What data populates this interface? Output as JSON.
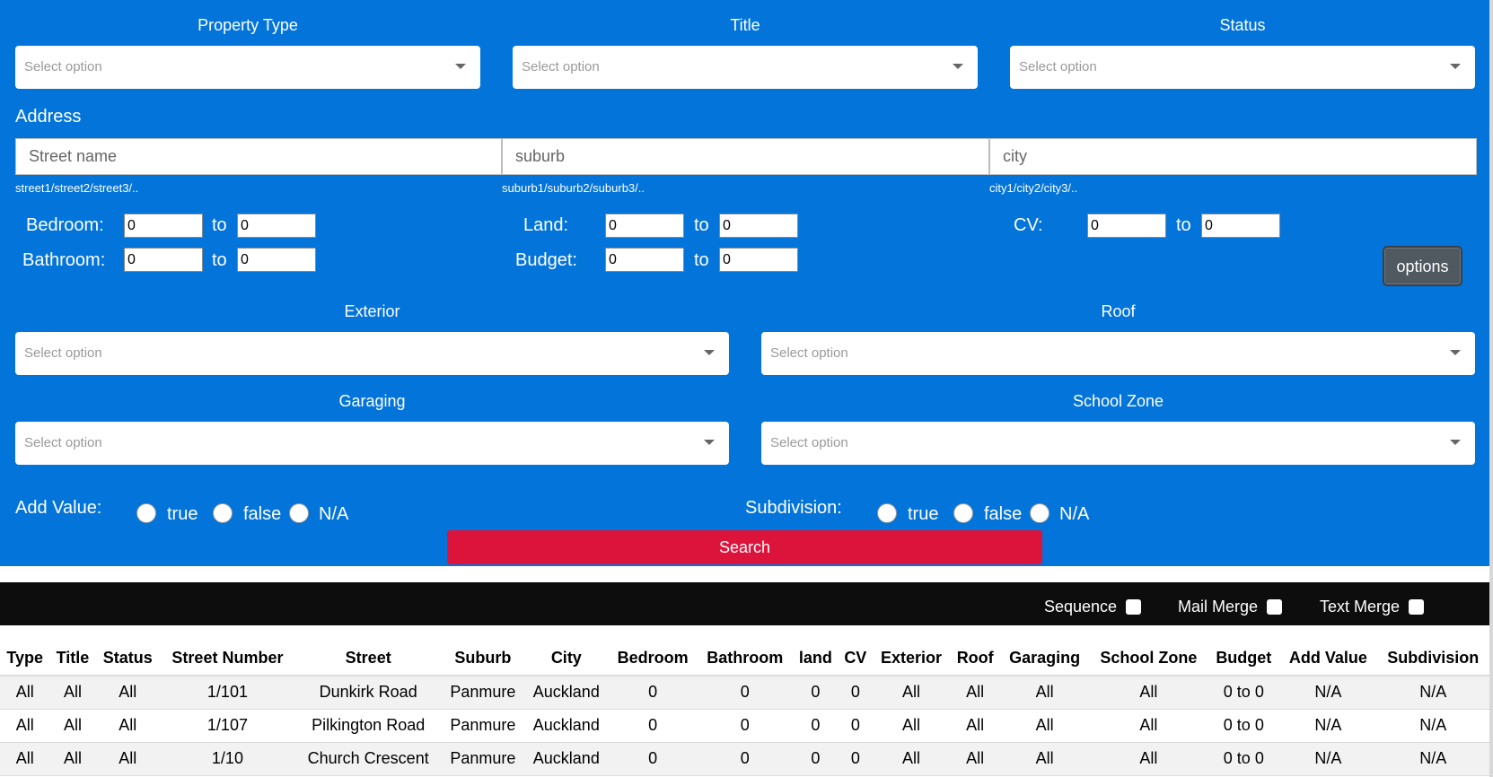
{
  "top_selects": [
    {
      "label": "Property Type",
      "placeholder": "Select option"
    },
    {
      "label": "Title",
      "placeholder": "Select option"
    },
    {
      "label": "Status",
      "placeholder": "Select option"
    }
  ],
  "address": {
    "title": "Address",
    "street": {
      "placeholder": "Street name",
      "hint": "street1/street2/street3/.."
    },
    "suburb": {
      "placeholder": "suburb",
      "hint": "suburb1/suburb2/suburb3/.."
    },
    "city": {
      "placeholder": "city",
      "hint": "city1/city2/city3/.."
    }
  },
  "ranges": {
    "to_label": "to",
    "bedroom": {
      "label": "Bedroom:",
      "from": "0",
      "to": "0"
    },
    "bathroom": {
      "label": "Bathroom:",
      "from": "0",
      "to": "0"
    },
    "land": {
      "label": "Land:",
      "from": "0",
      "to": "0"
    },
    "budget": {
      "label": "Budget:",
      "from": "0",
      "to": "0"
    },
    "cv": {
      "label": "CV:",
      "from": "0",
      "to": "0"
    }
  },
  "options_button": "options",
  "mid_selects": [
    {
      "label": "Exterior",
      "placeholder": "Select option"
    },
    {
      "label": "Roof",
      "placeholder": "Select option"
    },
    {
      "label": "Garaging",
      "placeholder": "Select option"
    },
    {
      "label": "School Zone",
      "placeholder": "Select option"
    }
  ],
  "add_value": {
    "label": "Add Value:",
    "options": [
      "true",
      "false",
      "N/A"
    ]
  },
  "subdivision": {
    "label": "Subdivision:",
    "options": [
      "true",
      "false",
      "N/A"
    ]
  },
  "search_button": "Search",
  "toolbar": {
    "sequence": "Sequence",
    "mail_merge": "Mail Merge",
    "text_merge": "Text Merge"
  },
  "table": {
    "headers": [
      "Type",
      "Title",
      "Status",
      "Street Number",
      "Street",
      "Suburb",
      "City",
      "Bedroom",
      "Bathroom",
      "land",
      "CV",
      "Exterior",
      "Roof",
      "Garaging",
      "School Zone",
      "Budget",
      "Add Value",
      "Subdivision"
    ],
    "rows": [
      [
        "All",
        "All",
        "All",
        "1/101",
        "Dunkirk Road",
        "Panmure",
        "Auckland",
        "0",
        "0",
        "0",
        "0",
        "All",
        "All",
        "All",
        "All",
        "0 to 0",
        "N/A",
        "N/A"
      ],
      [
        "All",
        "All",
        "All",
        "1/107",
        "Pilkington Road",
        "Panmure",
        "Auckland",
        "0",
        "0",
        "0",
        "0",
        "All",
        "All",
        "All",
        "All",
        "0 to 0",
        "N/A",
        "N/A"
      ],
      [
        "All",
        "All",
        "All",
        "1/10",
        "Church Crescent",
        "Panmure",
        "Auckland",
        "0",
        "0",
        "0",
        "0",
        "All",
        "All",
        "All",
        "All",
        "0 to 0",
        "N/A",
        "N/A"
      ]
    ]
  }
}
